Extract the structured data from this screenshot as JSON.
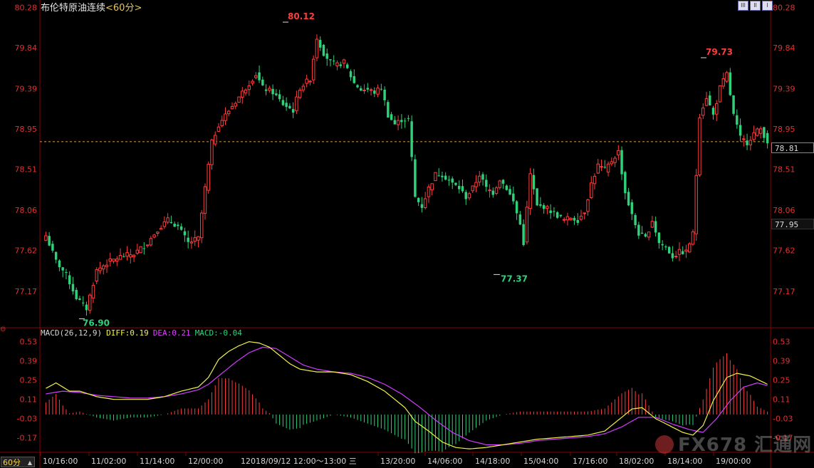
{
  "title": {
    "name": "布伦特原油连续",
    "period": "<60分>"
  },
  "period_tab": "60分",
  "toolbar_buttons": [
    "lll",
    "ll",
    "l"
  ],
  "price_tags": {
    "reference": "78.81",
    "current": "77.95"
  },
  "macd_header": {
    "label": "MACD(26,12,9)",
    "diff": "DIFF:0.19",
    "dea": "DEA:0.21",
    "macd": "MACD:-0.04"
  },
  "time_cursor": "12018/09/12 12:00～13:00 三",
  "watermark": {
    "brand": "FX678",
    "cn": "汇通网"
  },
  "colors": {
    "up": "#ff3c3c",
    "down": "#2fd17a",
    "diff": "#f2f24a",
    "dea": "#d23cff",
    "axis": "#e23030",
    "grid": "#8a0000"
  },
  "chart_data": [
    {
      "type": "candlestick",
      "price_axis": {
        "ticks": [
          "80.28",
          "79.84",
          "79.39",
          "78.95",
          "78.51",
          "78.06",
          "77.62",
          "77.17"
        ],
        "range": [
          76.85,
          80.3
        ]
      },
      "time_axis": [
        "10/16:00",
        "11/02:00",
        "11/14:00",
        "12/00:00",
        "12/20:00",
        "13/20:00",
        "14/06:00",
        "14/18:00",
        "15/04:00",
        "17/16:00",
        "18/02:00",
        "18/14:00",
        "19/00:00"
      ],
      "annotations": {
        "high": "80.12",
        "low": "76.90",
        "local_low": "77.37",
        "local_high": "79.73"
      },
      "reference_line": 78.81,
      "anchors": [
        [
          0,
          77.78
        ],
        [
          3,
          77.5
        ],
        [
          6,
          77.35
        ],
        [
          9,
          77.1
        ],
        [
          12,
          76.98
        ],
        [
          15,
          77.4
        ],
        [
          18,
          77.48
        ],
        [
          22,
          77.55
        ],
        [
          26,
          77.58
        ],
        [
          30,
          77.7
        ],
        [
          33,
          77.85
        ],
        [
          36,
          77.95
        ],
        [
          39,
          77.88
        ],
        [
          42,
          77.7
        ],
        [
          45,
          77.75
        ],
        [
          47,
          78.3
        ],
        [
          49,
          78.8
        ],
        [
          51,
          79.0
        ],
        [
          54,
          79.15
        ],
        [
          57,
          79.3
        ],
        [
          60,
          79.45
        ],
        [
          62,
          79.55
        ],
        [
          64,
          79.4
        ],
        [
          67,
          79.35
        ],
        [
          70,
          79.22
        ],
        [
          73,
          79.15
        ],
        [
          75,
          79.4
        ],
        [
          78,
          79.5
        ],
        [
          80,
          79.95
        ],
        [
          82,
          79.78
        ],
        [
          84,
          79.68
        ],
        [
          86,
          79.65
        ],
        [
          88,
          79.68
        ],
        [
          91,
          79.45
        ],
        [
          93,
          79.38
        ],
        [
          95,
          79.38
        ],
        [
          97,
          79.35
        ],
        [
          99,
          79.4
        ],
        [
          101,
          79.1
        ],
        [
          103,
          79.0
        ],
        [
          105,
          79.05
        ],
        [
          107,
          79.05
        ],
        [
          109,
          78.2
        ],
        [
          111,
          78.1
        ],
        [
          113,
          78.3
        ],
        [
          115,
          78.45
        ],
        [
          117,
          78.45
        ],
        [
          120,
          78.35
        ],
        [
          122,
          78.3
        ],
        [
          124,
          78.2
        ],
        [
          126,
          78.3
        ],
        [
          128,
          78.45
        ],
        [
          130,
          78.3
        ],
        [
          132,
          78.25
        ],
        [
          134,
          78.4
        ],
        [
          136,
          78.3
        ],
        [
          138,
          78.15
        ],
        [
          140,
          77.9
        ],
        [
          141,
          77.7
        ],
        [
          143,
          78.45
        ],
        [
          145,
          78.1
        ],
        [
          147,
          78.1
        ],
        [
          149,
          78.05
        ],
        [
          151,
          78.0
        ],
        [
          153,
          77.95
        ],
        [
          155,
          77.98
        ],
        [
          157,
          77.95
        ],
        [
          159,
          78.05
        ],
        [
          161,
          78.35
        ],
        [
          163,
          78.55
        ],
        [
          165,
          78.5
        ],
        [
          167,
          78.6
        ],
        [
          169,
          78.7
        ],
        [
          171,
          78.25
        ],
        [
          173,
          78.0
        ],
        [
          175,
          77.8
        ],
        [
          177,
          77.75
        ],
        [
          179,
          77.95
        ],
        [
          181,
          77.7
        ],
        [
          183,
          77.65
        ],
        [
          185,
          77.55
        ],
        [
          187,
          77.6
        ],
        [
          189,
          77.6
        ],
        [
          191,
          77.8
        ],
        [
          193,
          79.1
        ],
        [
          195,
          79.3
        ],
        [
          197,
          79.1
        ],
        [
          199,
          79.4
        ],
        [
          201,
          79.55
        ],
        [
          203,
          79.1
        ],
        [
          205,
          78.85
        ],
        [
          207,
          78.8
        ],
        [
          209,
          78.9
        ],
        [
          211,
          78.95
        ],
        [
          213,
          78.81
        ]
      ],
      "bars": 214
    },
    {
      "type": "macd",
      "params": [
        26,
        12,
        9
      ],
      "y_axis": {
        "ticks": [
          "0.53",
          "0.39",
          "0.25",
          "0.11",
          "-0.03",
          "-0.17"
        ],
        "range": [
          -0.27,
          0.58
        ]
      },
      "diff_anchors": [
        [
          0,
          0.19
        ],
        [
          3,
          0.23
        ],
        [
          7,
          0.17
        ],
        [
          10,
          0.17
        ],
        [
          15,
          0.13
        ],
        [
          20,
          0.11
        ],
        [
          25,
          0.11
        ],
        [
          30,
          0.11
        ],
        [
          35,
          0.13
        ],
        [
          40,
          0.17
        ],
        [
          45,
          0.2
        ],
        [
          48,
          0.27
        ],
        [
          51,
          0.4
        ],
        [
          54,
          0.46
        ],
        [
          57,
          0.5
        ],
        [
          60,
          0.53
        ],
        [
          63,
          0.52
        ],
        [
          66,
          0.49
        ],
        [
          69,
          0.43
        ],
        [
          72,
          0.37
        ],
        [
          75,
          0.33
        ],
        [
          80,
          0.31
        ],
        [
          85,
          0.31
        ],
        [
          90,
          0.29
        ],
        [
          95,
          0.24
        ],
        [
          100,
          0.17
        ],
        [
          103,
          0.11
        ],
        [
          106,
          0.05
        ],
        [
          109,
          -0.05
        ],
        [
          113,
          -0.12
        ],
        [
          117,
          -0.2
        ],
        [
          121,
          -0.24
        ],
        [
          125,
          -0.25
        ],
        [
          130,
          -0.24
        ],
        [
          135,
          -0.22
        ],
        [
          140,
          -0.2
        ],
        [
          145,
          -0.18
        ],
        [
          150,
          -0.17
        ],
        [
          155,
          -0.16
        ],
        [
          160,
          -0.15
        ],
        [
          165,
          -0.12
        ],
        [
          169,
          -0.04
        ],
        [
          173,
          0.04
        ],
        [
          176,
          0.05
        ],
        [
          180,
          -0.03
        ],
        [
          184,
          -0.08
        ],
        [
          188,
          -0.13
        ],
        [
          191,
          -0.15
        ],
        [
          194,
          -0.08
        ],
        [
          197,
          0.1
        ],
        [
          201,
          0.27
        ],
        [
          204,
          0.3
        ],
        [
          208,
          0.28
        ],
        [
          213,
          0.22
        ]
      ],
      "dea_anchors": [
        [
          0,
          0.15
        ],
        [
          5,
          0.17
        ],
        [
          10,
          0.16
        ],
        [
          15,
          0.14
        ],
        [
          20,
          0.13
        ],
        [
          25,
          0.12
        ],
        [
          30,
          0.12
        ],
        [
          35,
          0.13
        ],
        [
          40,
          0.15
        ],
        [
          45,
          0.18
        ],
        [
          48,
          0.22
        ],
        [
          52,
          0.3
        ],
        [
          56,
          0.38
        ],
        [
          60,
          0.45
        ],
        [
          64,
          0.49
        ],
        [
          68,
          0.48
        ],
        [
          72,
          0.42
        ],
        [
          76,
          0.36
        ],
        [
          80,
          0.33
        ],
        [
          85,
          0.31
        ],
        [
          90,
          0.3
        ],
        [
          95,
          0.27
        ],
        [
          100,
          0.22
        ],
        [
          105,
          0.15
        ],
        [
          110,
          0.06
        ],
        [
          115,
          -0.04
        ],
        [
          120,
          -0.13
        ],
        [
          125,
          -0.19
        ],
        [
          130,
          -0.22
        ],
        [
          135,
          -0.22
        ],
        [
          140,
          -0.21
        ],
        [
          145,
          -0.19
        ],
        [
          150,
          -0.18
        ],
        [
          155,
          -0.17
        ],
        [
          160,
          -0.16
        ],
        [
          165,
          -0.14
        ],
        [
          170,
          -0.09
        ],
        [
          175,
          -0.02
        ],
        [
          180,
          -0.02
        ],
        [
          185,
          -0.07
        ],
        [
          190,
          -0.11
        ],
        [
          194,
          -0.13
        ],
        [
          198,
          -0.03
        ],
        [
          202,
          0.1
        ],
        [
          206,
          0.2
        ],
        [
          210,
          0.23
        ],
        [
          213,
          0.21
        ]
      ]
    }
  ]
}
